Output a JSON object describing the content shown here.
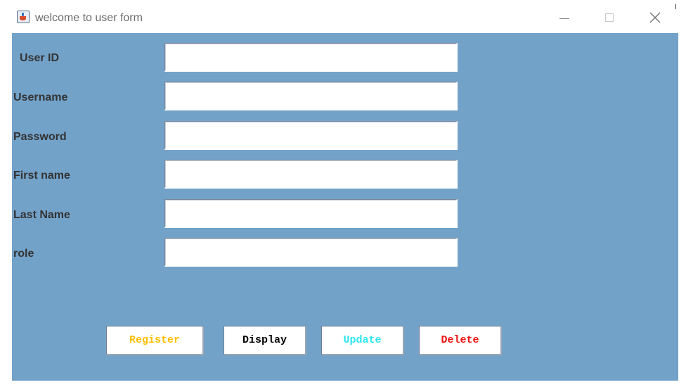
{
  "window": {
    "title": "welcome to user form",
    "icon": "java-cup-icon",
    "controls": [
      "minimize-icon",
      "maximize-icon",
      "close-icon"
    ]
  },
  "form": {
    "fields": [
      {
        "label": "User ID",
        "value": ""
      },
      {
        "label": "Username",
        "value": ""
      },
      {
        "label": "Password",
        "value": ""
      },
      {
        "label": "First name",
        "value": ""
      },
      {
        "label": "Last Name",
        "value": ""
      },
      {
        "label": "role",
        "value": ""
      }
    ],
    "background_color": "#73a2c9"
  },
  "buttons": [
    {
      "label": "Register",
      "color": "#ffc000"
    },
    {
      "label": "Display",
      "color": "#000000"
    },
    {
      "label": "Update",
      "color": "#2ee6f0"
    },
    {
      "label": "Delete",
      "color": "#ee1111"
    }
  ]
}
